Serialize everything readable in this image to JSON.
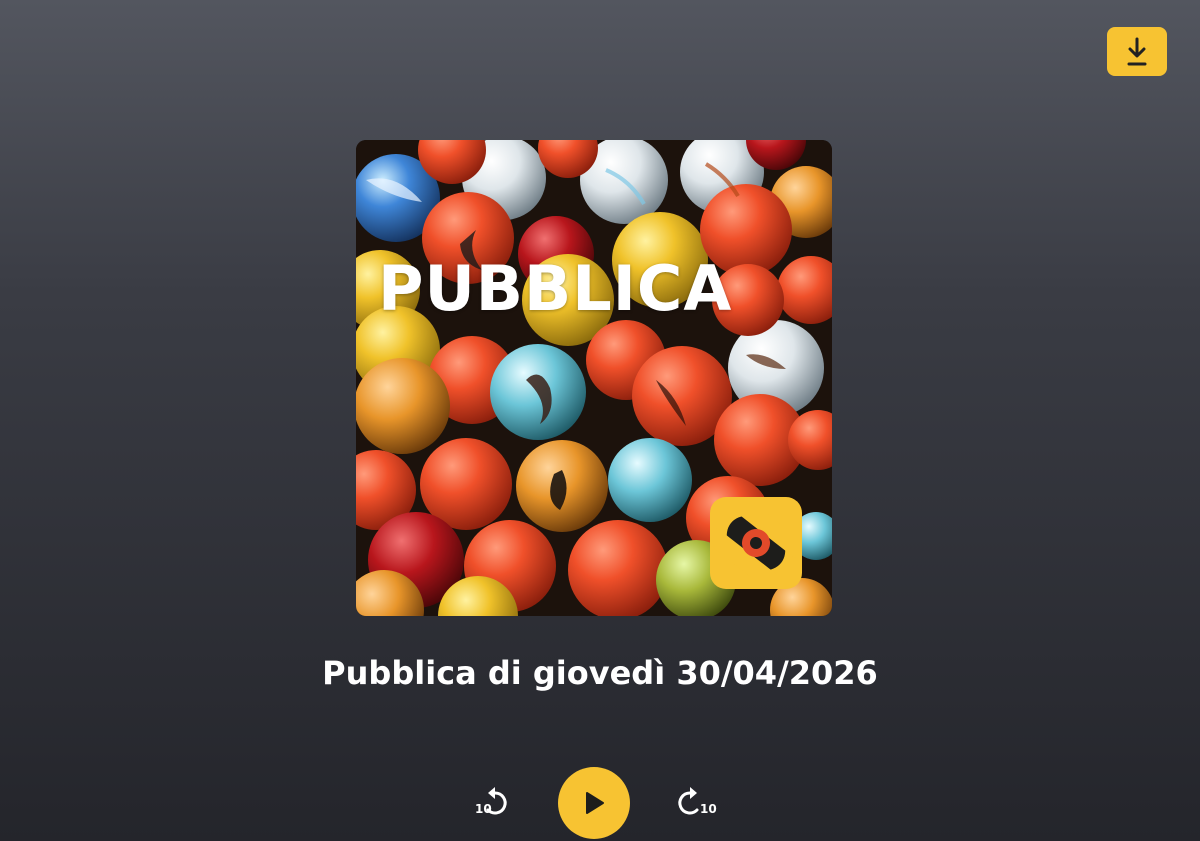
{
  "header": {
    "download_icon": "download-icon",
    "accent_color": "#f7c332"
  },
  "cover": {
    "title": "PUBBLICA",
    "logo_icon": "il-post-logo"
  },
  "episode": {
    "title": "Pubblica di giovedì 30/04/2026"
  },
  "controls": {
    "skip_back_seconds": "10",
    "skip_forward_seconds": "10",
    "play_icon": "play-icon",
    "skip_back_icon": "rewind-icon",
    "skip_forward_icon": "forward-icon"
  },
  "colors": {
    "background_top": "#53565f",
    "background_bottom": "#24252b",
    "accent": "#f7c332",
    "text": "#ffffff"
  }
}
